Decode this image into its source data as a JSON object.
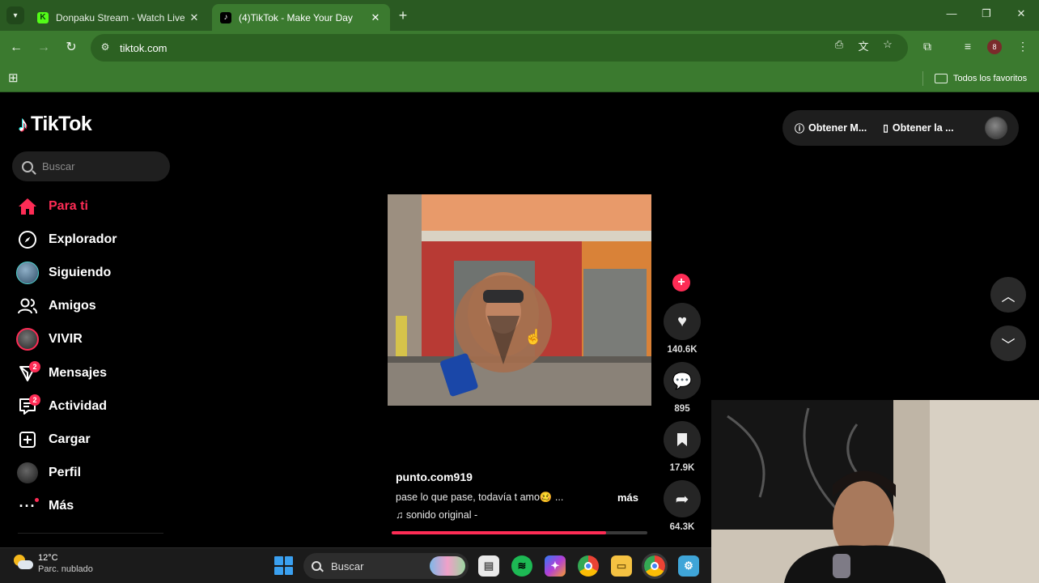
{
  "browser": {
    "tabs": [
      {
        "title": "Donpaku Stream - Watch Live c",
        "favicon": "kick-icon"
      },
      {
        "title": "(4)TikTok - Make Your Day",
        "favicon": "tiktok-icon"
      }
    ],
    "url": "tiktok.com",
    "bookmarks_folder": "Todos los favoritos",
    "profile_initial": "8"
  },
  "tiktok": {
    "logo": "TikTok",
    "search_placeholder": "Buscar",
    "nav": [
      {
        "label": "Para ti",
        "icon": "home-icon",
        "active": true
      },
      {
        "label": "Explorador",
        "icon": "compass-icon"
      },
      {
        "label": "Siguiendo",
        "icon": "following-avatar-icon"
      },
      {
        "label": "Amigos",
        "icon": "friends-icon"
      },
      {
        "label": "VIVIR",
        "icon": "live-icon"
      },
      {
        "label": "Mensajes",
        "icon": "messages-icon",
        "badge": "2"
      },
      {
        "label": "Actividad",
        "icon": "activity-icon",
        "badge": "2"
      },
      {
        "label": "Cargar",
        "icon": "upload-icon"
      },
      {
        "label": "Perfil",
        "icon": "profile-avatar-icon"
      },
      {
        "label": "Más",
        "icon": "more-icon"
      }
    ],
    "top_actions": [
      {
        "label": "Obtener M...",
        "icon": "tiktok-circle-icon"
      },
      {
        "label": "Obtener la ...",
        "icon": "phone-icon"
      }
    ],
    "video": {
      "username": "punto.com919",
      "description": "pase lo que pase, todavía t amo🥴 ...",
      "more_label": "más",
      "sound": "sonido original -",
      "progress": 0.84
    },
    "actions": {
      "likes": "140.6K",
      "comments": "895",
      "saves": "17.9K",
      "shares": "64.3K"
    }
  },
  "taskbar": {
    "temperature": "12°C",
    "condition": "Parc. nublado",
    "search_label": "Buscar"
  },
  "colors": {
    "tiktok_accent": "#fe2c55",
    "browser_green": "#3b7a2f"
  }
}
